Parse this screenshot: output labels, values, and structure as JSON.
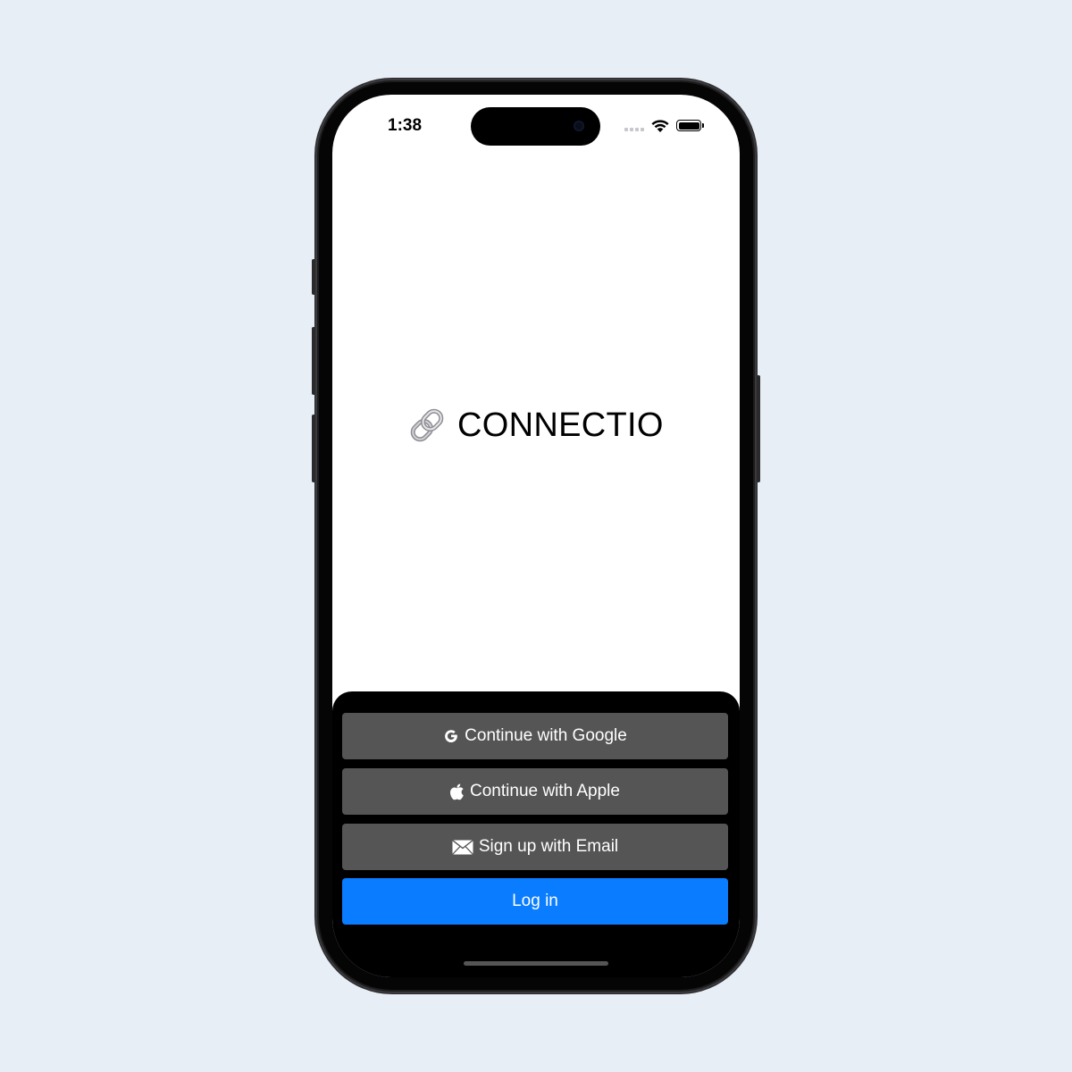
{
  "status_bar": {
    "time": "1:38",
    "icons": [
      "signal-icon",
      "wifi-icon",
      "battery-icon"
    ]
  },
  "brand": {
    "icon": "link-icon",
    "name": "CONNECTIO"
  },
  "auth_sheet": {
    "google_label": "Continue with Google",
    "google_icon": "google-icon",
    "apple_label": "Continue with Apple",
    "apple_icon": "apple-icon",
    "email_label": "Sign up with Email",
    "email_icon": "envelope-icon",
    "login_label": "Log in"
  },
  "colors": {
    "background": "#e8eef6",
    "button_secondary": "#555555",
    "button_primary": "#0a7cff",
    "sheet": "#000000"
  }
}
